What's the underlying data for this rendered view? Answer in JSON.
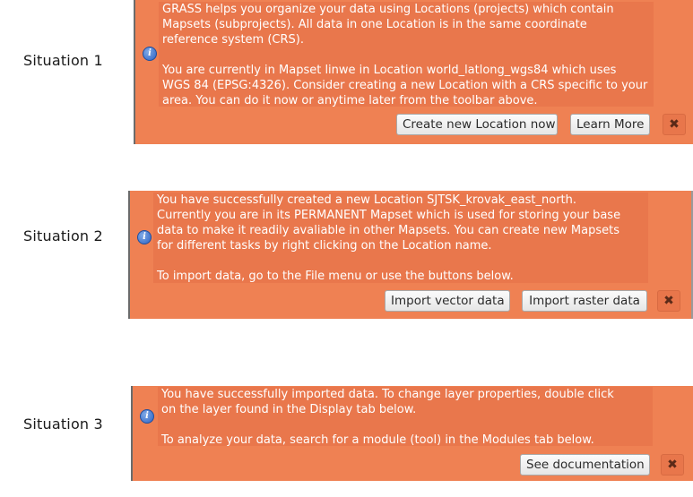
{
  "situations": [
    {
      "label": "Situation 1",
      "message": "GRASS helps you organize your data using Locations (projects) which contain\nMapsets (subprojects). All data in one Location is in the same coordinate\nreference system (CRS).\n\nYou are currently in Mapset linwe in Location world_latlong_wgs84 which uses\nWGS 84 (EPSG:4326). Consider creating a new Location with a CRS specific to your\narea. You can do it now or anytime later from the toolbar above.",
      "buttons": [
        "Create new Location now",
        "Learn More"
      ],
      "close": "✖"
    },
    {
      "label": "Situation 2",
      "message": "You have successfully created a new Location SJTSK_krovak_east_north.\nCurrently you are in its PERMANENT Mapset which is used for storing your base\ndata to make it readily avaliable in other Mapsets. You can create new Mapsets\nfor different tasks by right clicking on the Location name.\n\nTo import data, go to the File menu or use the buttons below.",
      "buttons": [
        "Import vector data",
        "Import raster data"
      ],
      "close": "✖"
    },
    {
      "label": "Situation 3",
      "message": "You have successfully imported data. To change layer properties, double click\non the layer found in the Display tab below.\n\nTo analyze your data, search for a module (tool) in the Modules tab below.",
      "buttons": [
        "See documentation"
      ],
      "close": "✖"
    }
  ],
  "info_icon": "i",
  "colors": {
    "panel": "#ef8153",
    "message_bg": "#e9774c",
    "text": "#ffffff"
  }
}
